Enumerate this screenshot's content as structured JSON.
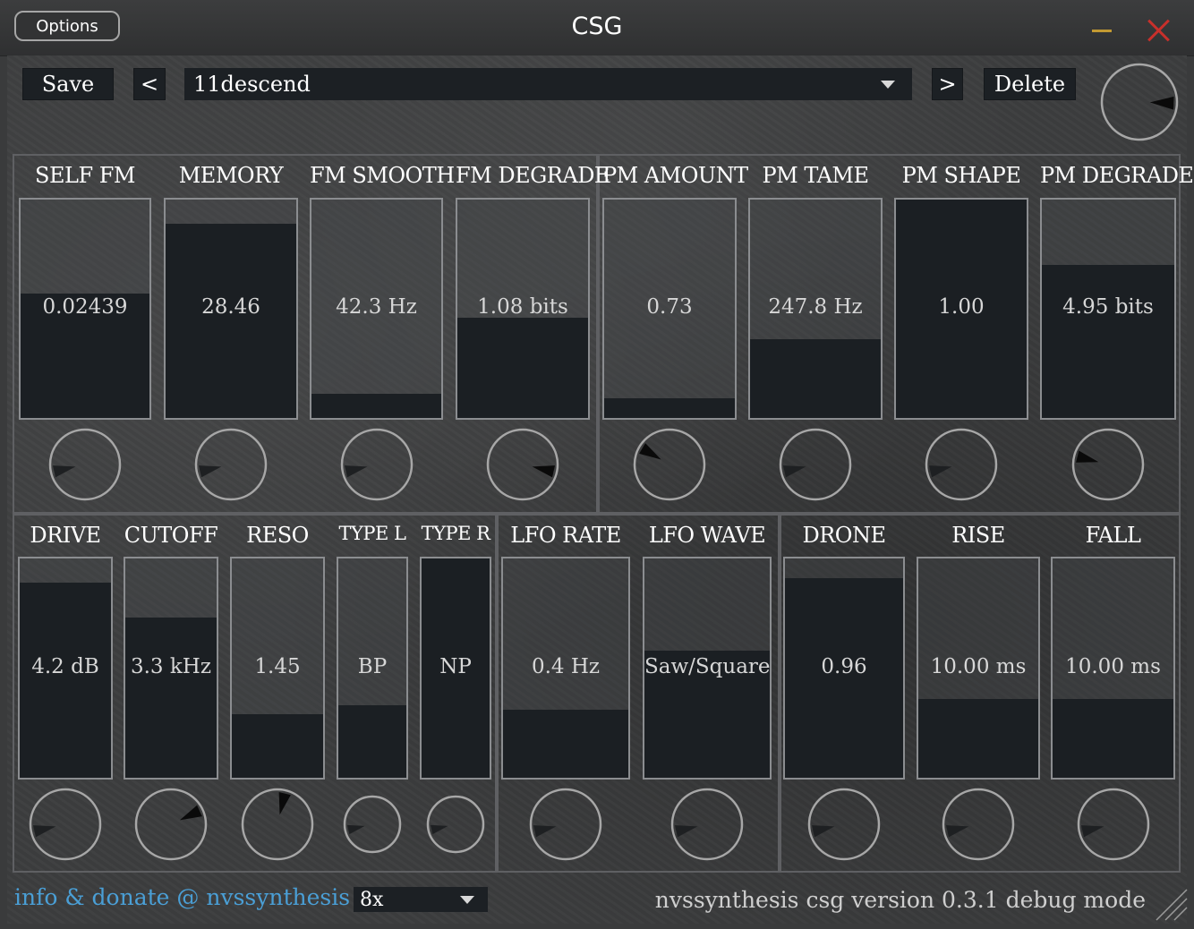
{
  "window": {
    "title": "CSG",
    "options_label": "Options"
  },
  "toolbar": {
    "save_label": "Save",
    "prev_label": "<",
    "next_label": ">",
    "delete_label": "Delete",
    "preset_name": "11descend",
    "master_knob_level": 0.84
  },
  "sections": {
    "fm": [
      {
        "label": "SELF FM",
        "value": "0.02439",
        "fill": 0.57,
        "knob": 0.12
      },
      {
        "label": "MEMORY",
        "value": "28.46",
        "fill": 0.89,
        "knob": 0.12
      },
      {
        "label": "FM SMOOTH",
        "value": "42.3 Hz",
        "fill": 0.11,
        "knob": 0.12
      },
      {
        "label": "FM DEGRADE",
        "value": "1.08 bits",
        "fill": 0.46,
        "knob": 0.88
      }
    ],
    "pm": [
      {
        "label": "PM AMOUNT",
        "value": "0.73",
        "fill": 0.09,
        "knob": 0.28
      },
      {
        "label": "PM TAME",
        "value": "247.8 Hz",
        "fill": 0.36,
        "knob": 0.12
      },
      {
        "label": "PM SHAPE",
        "value": "1.00",
        "fill": 1.0,
        "knob": 0.12
      },
      {
        "label": "PM DEGRADE",
        "value": "4.95 bits",
        "fill": 0.7,
        "knob": 0.22
      }
    ],
    "filter": [
      {
        "label": "DRIVE",
        "value": "4.2 dB",
        "fill": 0.89,
        "knob": 0.12
      },
      {
        "label": "CUTOFF",
        "value": "3.3 kHz",
        "fill": 0.73,
        "knob": 0.74
      },
      {
        "label": "RESO",
        "value": "1.45",
        "fill": 0.29,
        "knob": 0.55
      },
      {
        "label": "TYPE L",
        "value": "BP",
        "fill": 0.33,
        "knob": 0.12
      },
      {
        "label": "TYPE R",
        "value": "NP",
        "fill": 1.0,
        "knob": 0.12
      }
    ],
    "lfo": [
      {
        "label": "LFO RATE",
        "value": "0.4 Hz",
        "fill": 0.31,
        "knob": 0.12
      },
      {
        "label": "LFO WAVE",
        "value": "Saw/Square",
        "fill": 0.58,
        "knob": 0.12
      }
    ],
    "env": [
      {
        "label": "DRONE",
        "value": "0.96",
        "fill": 0.91,
        "knob": 0.12
      },
      {
        "label": "RISE",
        "value": "10.00 ms",
        "fill": 0.36,
        "knob": 0.12
      },
      {
        "label": "FALL",
        "value": "10.00 ms",
        "fill": 0.36,
        "knob": 0.12
      }
    ]
  },
  "footer": {
    "link_text": "info & donate @ nvssynthesis",
    "oversampling": "8x",
    "version_text": "nvssynthesis csg version 0.3.1 debug mode"
  },
  "colors": {
    "slider_fill": "#1b1f23",
    "link": "#4a9fd6",
    "close": "#c8302b",
    "minimize": "#c39a32"
  }
}
